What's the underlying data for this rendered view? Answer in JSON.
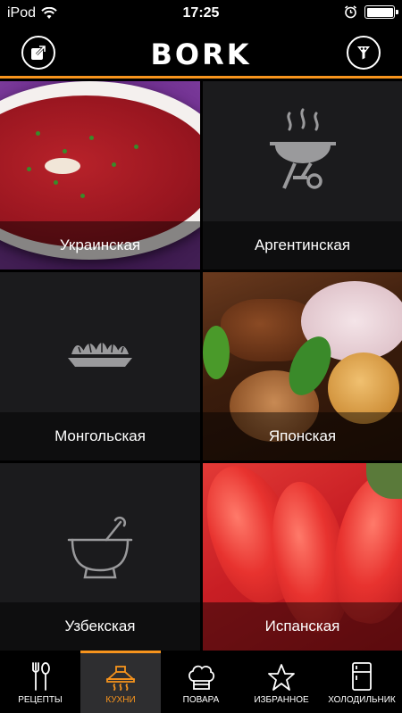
{
  "status_bar": {
    "carrier": "iPod",
    "time": "17:25",
    "battery_level": 1.0
  },
  "header": {
    "logo": "BORK",
    "share_icon": "share-icon",
    "filter_icon": "filter-icon",
    "accent_color": "#f7941d"
  },
  "cuisines": [
    {
      "label": "Украинская",
      "image": "borscht-photo"
    },
    {
      "label": "Аргентинская",
      "icon": "grill-icon"
    },
    {
      "label": "Монгольская",
      "icon": "dumplings-icon"
    },
    {
      "label": "Японская",
      "image": "japanese-dish-photo"
    },
    {
      "label": "Узбекская",
      "icon": "mortar-icon"
    },
    {
      "label": "Испанская",
      "image": "strawberries-photo"
    }
  ],
  "tabbar": {
    "tabs": [
      {
        "label": "РЕЦЕПТЫ",
        "icon": "cutlery-icon",
        "active": false
      },
      {
        "label": "КУХНИ",
        "icon": "kitchen-hood-icon",
        "active": true
      },
      {
        "label": "ПОВАРА",
        "icon": "chef-hat-icon",
        "active": false
      },
      {
        "label": "ИЗБРАННОЕ",
        "icon": "star-icon",
        "active": false
      },
      {
        "label": "ХОЛОДИЛЬНИК",
        "icon": "fridge-icon",
        "active": false
      }
    ]
  }
}
